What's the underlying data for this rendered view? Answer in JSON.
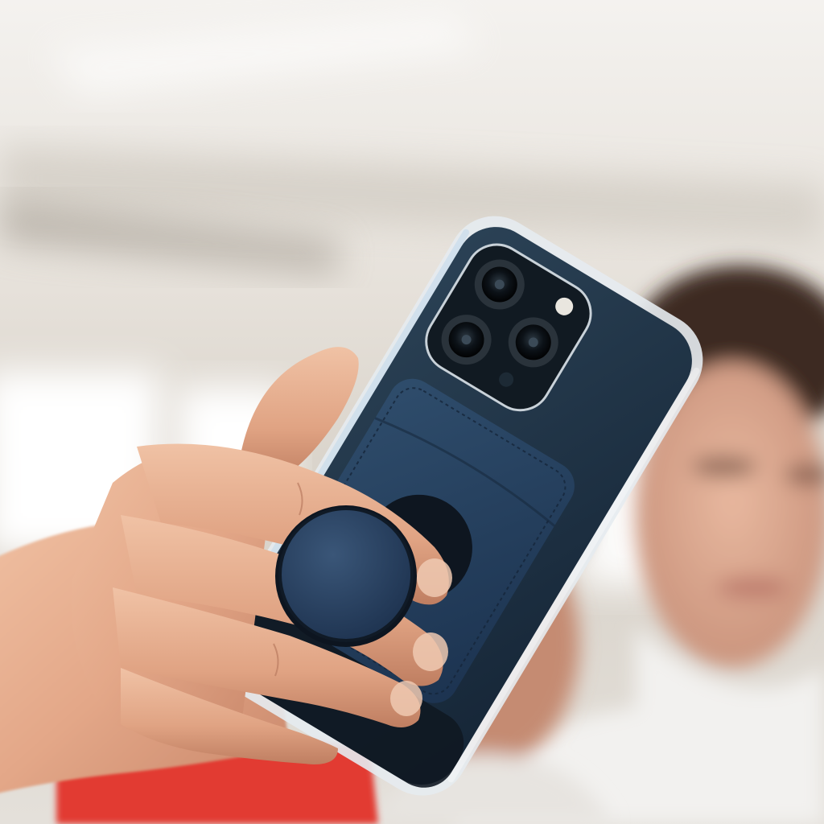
{
  "scene": {
    "kind": "photograph",
    "colors": {
      "ceiling": "#efece8",
      "wall": "#d9d4cc",
      "window_glow": "#ffffff",
      "skin": "#e2a98a",
      "skin_shadow": "#b9795b",
      "phone_case_edge": "#dfe5ea",
      "phone_body": "#1f3448",
      "wallet_leather": "#25405c",
      "grip_leather": "#2c4663",
      "shirt_red": "#e23a33",
      "shirt_white": "#f1f0ee",
      "hair": "#3a2a22"
    },
    "elements": [
      "smartphone-in-clear-case",
      "triple-camera-module",
      "leather-wallet-on-back",
      "circular-phone-grip",
      "hand-holding-phone",
      "blurred-woman-background",
      "blurred-man-background"
    ]
  }
}
